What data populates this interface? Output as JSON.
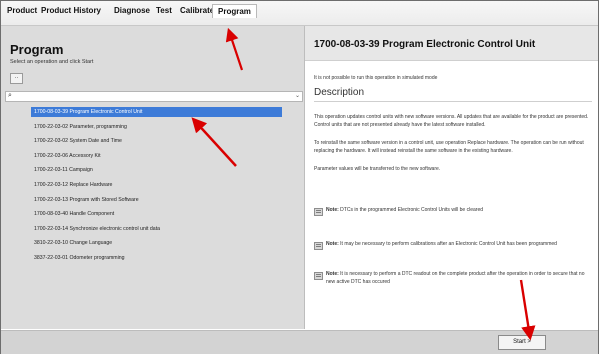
{
  "menu": {
    "items": [
      "Product",
      "Product History",
      "Diagnose",
      "Test",
      "Calibrate",
      "Program"
    ],
    "active": "Program"
  },
  "left": {
    "title": "Program",
    "subtitle": "Select an operation and click Start",
    "collapse_label": "..",
    "search_placeholder": "",
    "operations": [
      "1700-08-03-39 Program Electronic Control Unit",
      "1700-22-03-02 Parameter, programming",
      "1700-22-03-02 System Date and Time",
      "1700-22-03-06 Accessory Kit",
      "1700-22-03-11 Campaign",
      "1700-22-03-12 Replace Hardware",
      "1700-22-03-13 Program with Stored Software",
      "1700-08-03-40 Handle Component",
      "1700-22-03-14 Synchronize electronic control unit data",
      "3810-22-03-10 Change Language",
      "3837-22-03-01 Odometer programming"
    ],
    "selected_index": 0
  },
  "right": {
    "title": "1700-08-03-39 Program Electronic Control Unit",
    "simulated_note": "It is not possible to run this operation in simulated mode",
    "description_heading": "Description",
    "paragraphs": [
      "This operation updates control units with new software versions. All updates that are available for the product are presented. Control units that are not presented already have the latest software installed.",
      "To reinstall the same software version in a control unit, use operation Replace hardware. The operation can be run without replacing the hardware. It will instead reinstall the same software in the existing hardware.",
      "Parameter values will be transferred to the new software."
    ],
    "notes": [
      {
        "label": "Note:",
        "text": "DTCs in the programmed Electronic Control Units will be cleared"
      },
      {
        "label": "Note:",
        "text": "It may be necessary to perform calibrations after an Electronic Control Unit has been programmed"
      },
      {
        "label": "Note:",
        "text": "It is necessary to perform a DTC readout on the complete product after the operation in order to secure that no new active DTC has occured"
      }
    ]
  },
  "bottom": {
    "start_label": "Start >"
  },
  "colors": {
    "selection": "#3d7bd8",
    "annotation_arrow": "#d90000"
  }
}
